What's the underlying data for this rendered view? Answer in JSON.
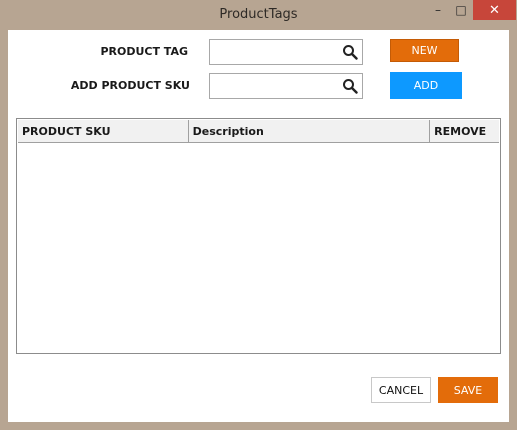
{
  "window": {
    "title": "ProductTags",
    "minimize_glyph": "–",
    "maximize_glyph": "□",
    "close_glyph": "✕"
  },
  "form": {
    "product_tag": {
      "label": "PRODUCT TAG",
      "value": "",
      "placeholder": ""
    },
    "add_sku": {
      "label": "ADD PRODUCT SKU",
      "value": "",
      "placeholder": ""
    },
    "new_label": "NEW",
    "add_label": "ADD"
  },
  "table": {
    "columns": [
      "PRODUCT SKU",
      "Description",
      "REMOVE"
    ],
    "rows": []
  },
  "footer": {
    "cancel_label": "CANCEL",
    "save_label": "SAVE"
  },
  "colors": {
    "accent_orange": "#e36c0a",
    "accent_blue": "#0d99ff",
    "close_red": "#c7463a"
  }
}
